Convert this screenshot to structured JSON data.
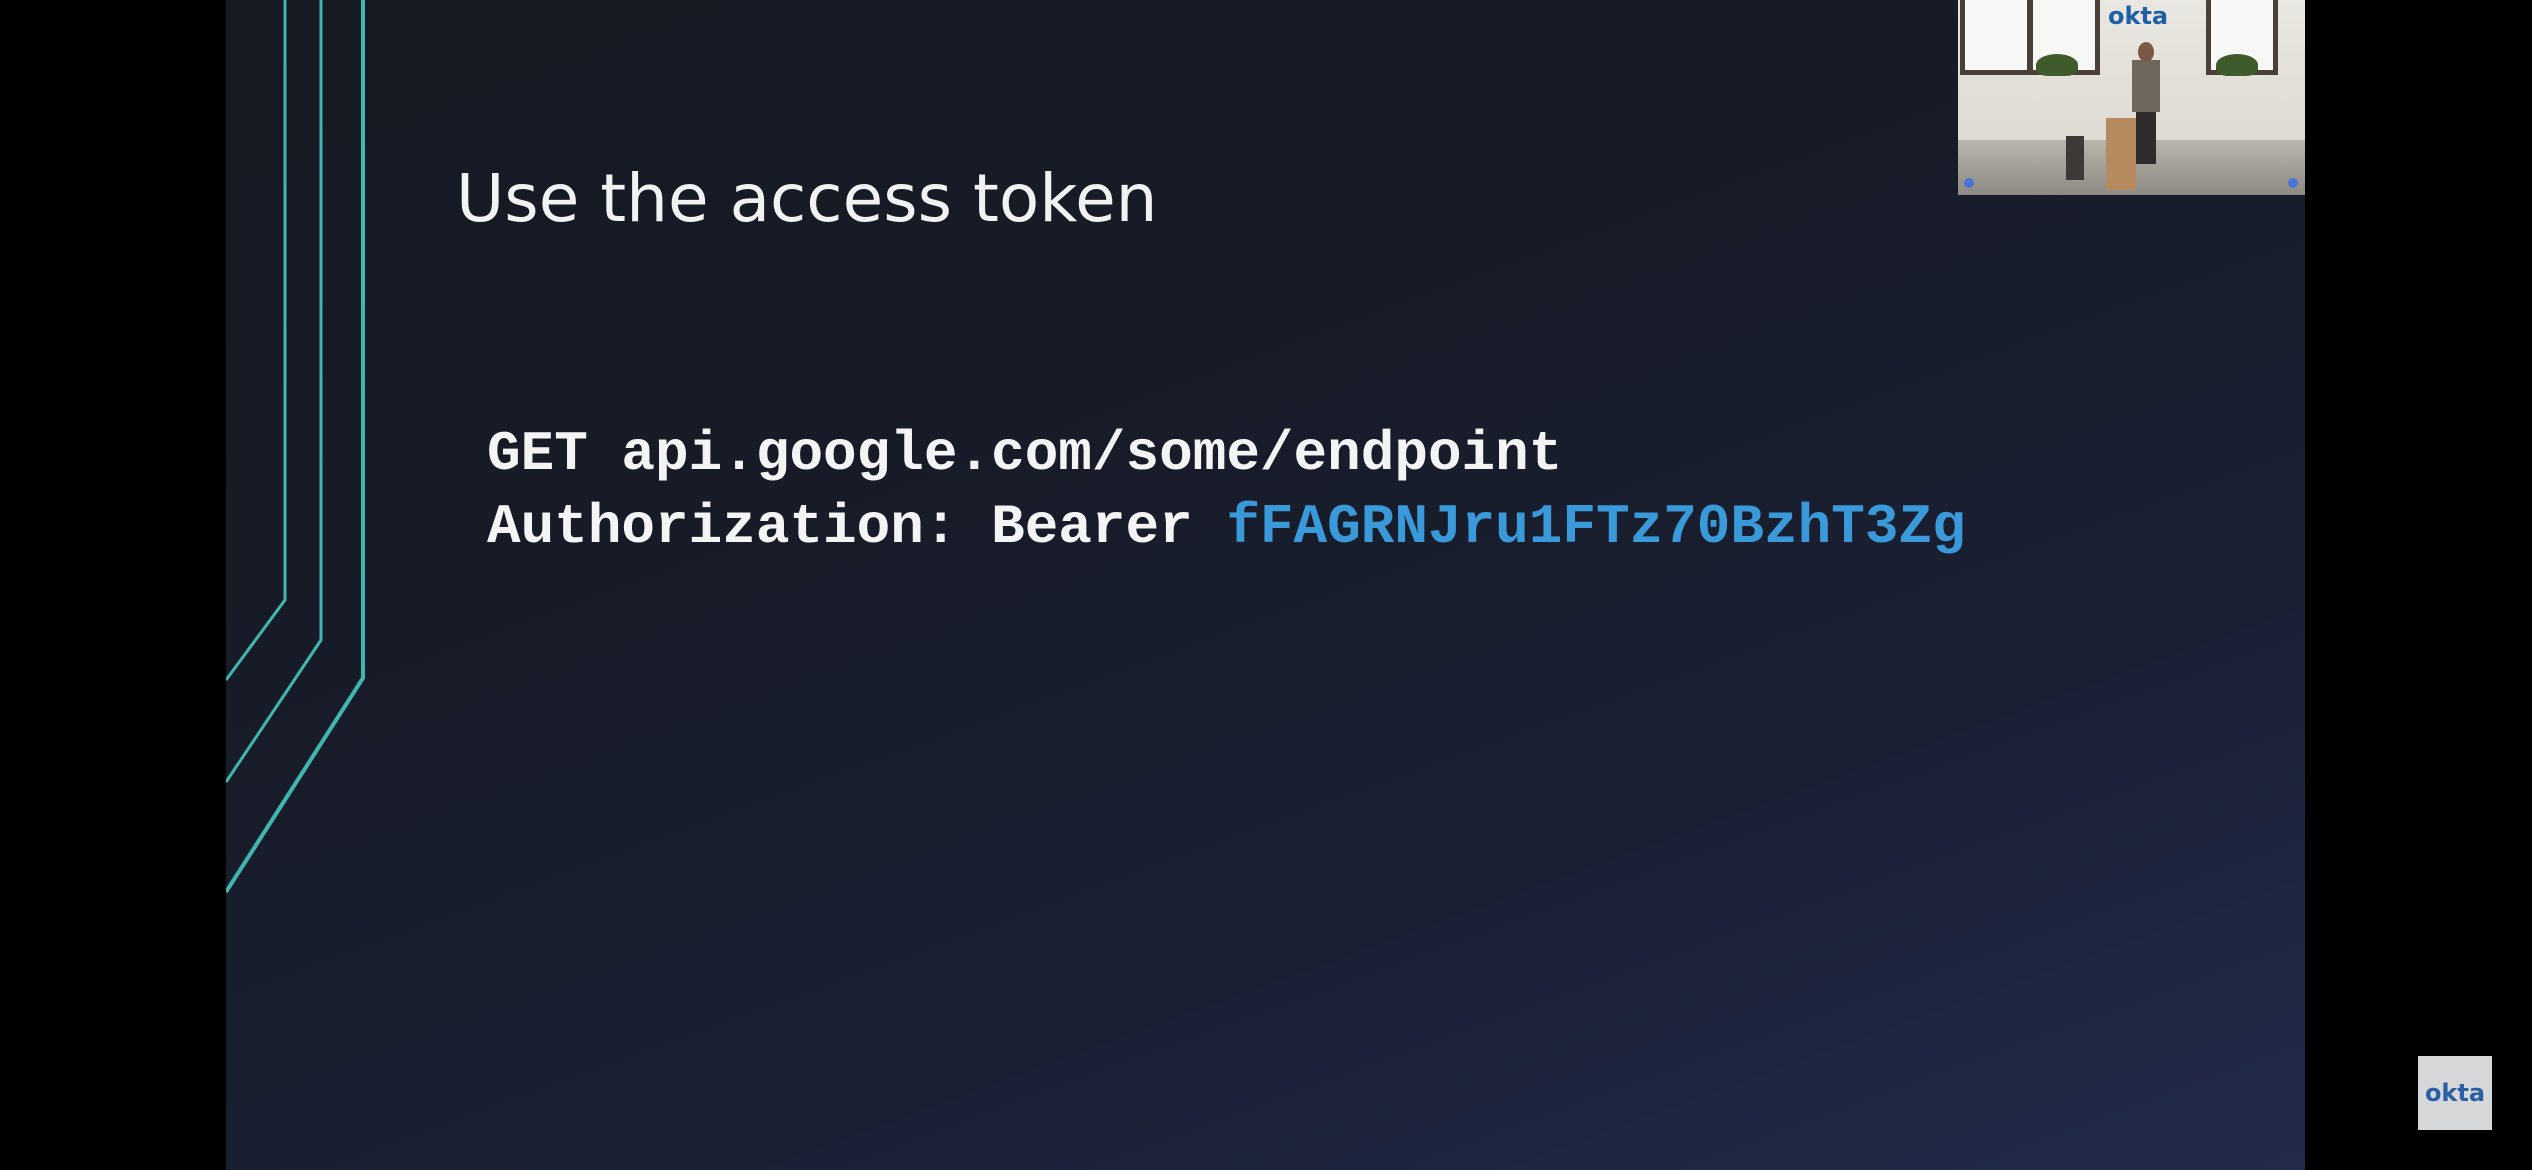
{
  "slide": {
    "title": "Use the access token",
    "code_line1": "GET api.google.com/some/endpoint",
    "code_line2_prefix": "Authorization: Bearer ",
    "code_line2_token": "fFAGRNJru1FTz70BzhT3Zg"
  },
  "speaker_video": {
    "wall_logo_text": "okta"
  },
  "watermark": {
    "logo_text": "okta"
  },
  "colors": {
    "slide_background": "#171b27",
    "accent_line": "#3fb7b0",
    "token_text": "#3a9ad9",
    "title_text": "#f2f2f2"
  }
}
